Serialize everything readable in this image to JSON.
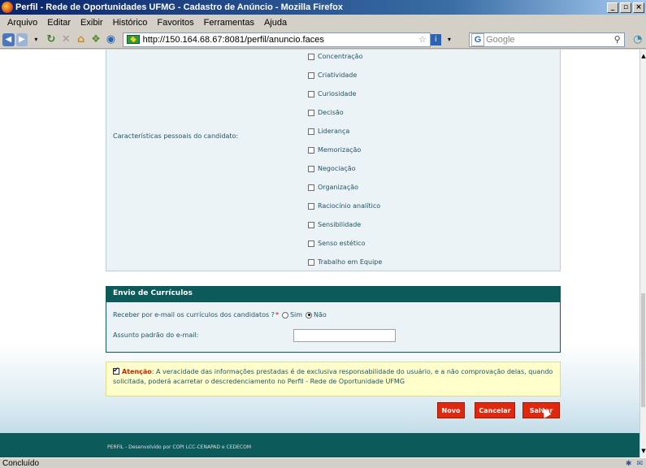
{
  "window": {
    "title": "Perfil - Rede de Oportunidades UFMG - Cadastro de Anúncio - Mozilla Firefox",
    "controls": [
      "_",
      "▫",
      "×"
    ]
  },
  "menu": [
    "Arquivo",
    "Editar",
    "Exibir",
    "Histórico",
    "Favoritos",
    "Ferramentas",
    "Ajuda"
  ],
  "nav": {
    "url": "http://150.164.68.67:8081/perfil/anuncio.faces",
    "search_placeholder": "Google"
  },
  "form": {
    "traits_label": "Características pessoais do candidato:",
    "traits": [
      "Concentração",
      "Criatividade",
      "Curiosidade",
      "Decisão",
      "Liderança",
      "Memorização",
      "Negociação",
      "Organização",
      "Raciocínio analítico",
      "Sensibilidade",
      "Senso estético",
      "Trabalho em Equipe"
    ],
    "section2_title": "Envio de Currículos",
    "receive_question": "Receber por e-mail os currículos dos candidatos ?",
    "required_mark": "*",
    "yes_label": "Sim",
    "no_label": "Não",
    "selected": "Não",
    "subject_label": "Assunto padrão do e-mail:",
    "subject_value": ""
  },
  "notice": {
    "bold": "Atenção",
    "text": ": A veracidade das informações prestadas é de exclusiva responsabilidade do usuário, e a não comprovação delas, quando solicitada, poderá acarretar o descredenciamento no Perfil - Rede de Oportunidade UFMG"
  },
  "buttons": {
    "new": "Novo",
    "cancel": "Cancelar",
    "save": "Salvar"
  },
  "footer": "PERFIL - Desenvolvido por COPI LCC-CENAPAD e CEDECOM",
  "status": "Concluído"
}
